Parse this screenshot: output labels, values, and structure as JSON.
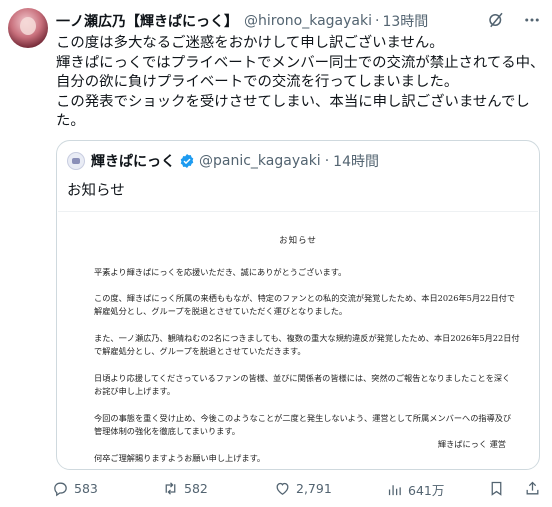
{
  "author": {
    "display_name": "一ノ瀬広乃【輝きぱにっく】",
    "handle": "@hirono_kagayaki",
    "time": "13時間"
  },
  "post_lines": [
    "この度は多大なるご迷惑をおかけして申し訳ございません。",
    "輝きぱにっくではプライベートでメンバー同士での交流が禁止されてる中、",
    "自分の欲に負けプライベートでの交流を行ってしまいました。",
    "この発表でショックを受けさせてしまい、本当に申し訳ございませんでし",
    "た。"
  ],
  "quote": {
    "display_name": "輝きぱにっく",
    "handle": "@panic_kagayaki",
    "time": "14時間",
    "text": "お知らせ",
    "notice": {
      "title": "お知らせ",
      "para1": [
        "平素より輝きぱにっくを応援いただき、誠にありがとうございます。"
      ],
      "para2": [
        "この度、輝きぱにっく所属の来栖ももなが、特定のファンとの私的交流が発覚したため、本日2026年5月22日付で",
        "解雇処分とし、グループを脱退とさせていただく運びとなりました。"
      ],
      "para3": [
        "また、一ノ瀬広乃、観晴ねむの2名につきましても、複数の重大な規約違反が発覚したため、本日2026年5月22日付",
        "で解雇処分とし、グループを脱退とさせていただきます。"
      ],
      "para4": [
        "日頃より応援してくださっているファンの皆様、並びに関係者の皆様には、突然のご報告となりましたことを深く",
        "お詫び申し上げます。"
      ],
      "para5": [
        "今回の事態を重く受け止め、今後このようなことが二度と発生しないよう、運営として所属メンバーへの指導及び",
        "管理体制の強化を徹底してまいります。"
      ],
      "para6": [
        "何卒ご理解賜りますようお願い申し上げます。"
      ],
      "signature": "輝きぱにっく 運営"
    }
  },
  "stats": {
    "replies": "583",
    "reposts": "582",
    "likes": "2,791",
    "views": "641万"
  },
  "colors": {
    "secondary_text": "#536471",
    "verified_badge": "#1d9bf0",
    "border": "#cfd9de"
  }
}
